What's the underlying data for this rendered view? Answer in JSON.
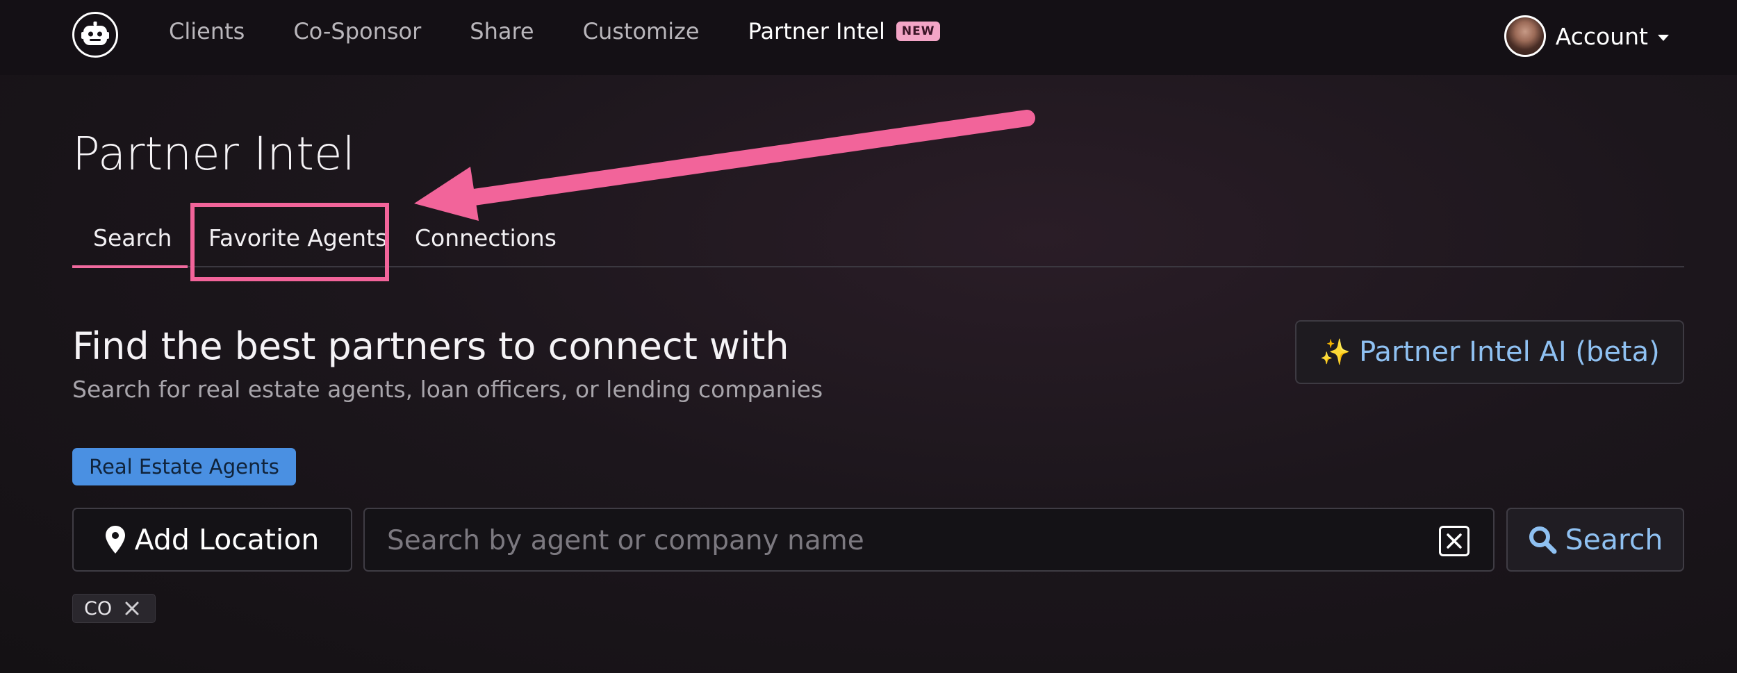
{
  "nav": {
    "links": [
      "Clients",
      "Co-Sponsor",
      "Share",
      "Customize"
    ],
    "active_link": "Partner Intel",
    "new_badge": "NEW",
    "account_label": "Account"
  },
  "page": {
    "title": "Partner Intel",
    "tabs": [
      "Search",
      "Favorite Agents",
      "Connections"
    ],
    "active_tab": "Search"
  },
  "section": {
    "heading": "Find the best partners to connect with",
    "subheading": "Search for real estate agents, loan officers, or lending companies",
    "ai_button_label": "Partner Intel AI (beta)",
    "ai_button_icon": "sparkles-icon",
    "category_chip": "Real Estate Agents"
  },
  "search": {
    "add_location_label": "Add Location",
    "input_value": "",
    "input_placeholder": "Search by agent or company name",
    "button_label": "Search"
  },
  "filters": {
    "locations": [
      "CO"
    ]
  },
  "colors": {
    "accent_pink": "#f2649a",
    "link_blue": "#8fc1f2",
    "chip_blue": "#4a90e2",
    "badge_pink": "#f3a5c6"
  }
}
